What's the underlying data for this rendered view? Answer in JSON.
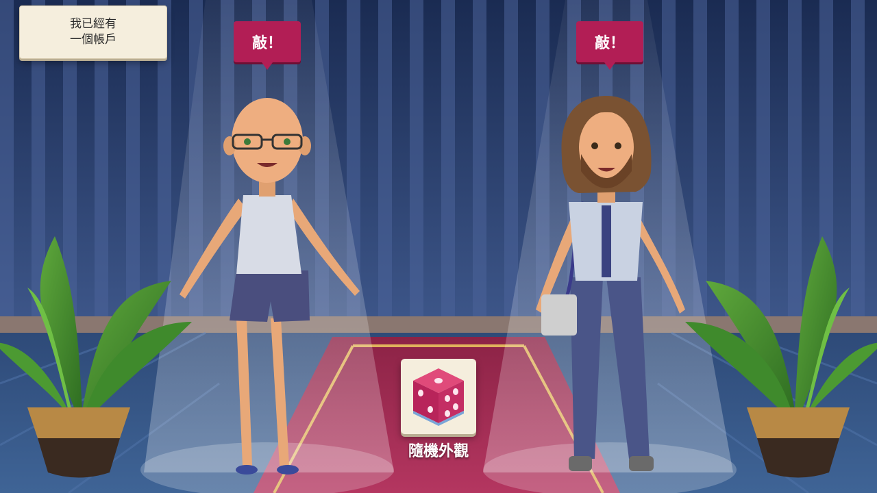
{
  "account_button": {
    "label": "我已經有\n一個帳戶"
  },
  "avatars": [
    {
      "knock_label": "敲！"
    },
    {
      "knock_label": "敲！"
    }
  ],
  "randomize": {
    "label": "隨機外觀",
    "icon": "dice-icon"
  },
  "colors": {
    "bubble": "#b21e55",
    "button_bg": "#f5eedd",
    "carpet": "#b0305a",
    "wall": "#2b3f6c",
    "floor": "#3a5a8a"
  }
}
